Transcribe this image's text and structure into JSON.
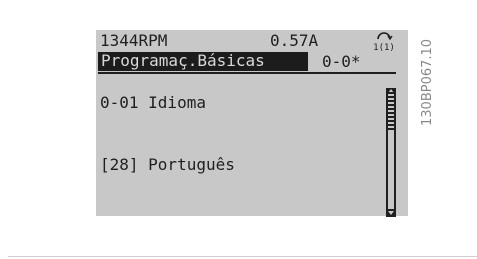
{
  "display": {
    "status": {
      "speed": "1344RPM",
      "current": "0.57A",
      "setup": "1(1)"
    },
    "menu": {
      "title": "Programaç.Básicas",
      "group": "0-0*"
    },
    "parameter": {
      "label": "0-01 Idioma"
    },
    "value": {
      "text": "[28] Português"
    }
  },
  "document_code": "130BP067.10",
  "colors": {
    "lcd_background": "#c8c8c8",
    "lcd_text": "#1f1f1f",
    "highlight_background": "#1c1c1c"
  },
  "icons": {
    "setup": "setup-indicator-icon",
    "scroll": "scrollbar"
  }
}
